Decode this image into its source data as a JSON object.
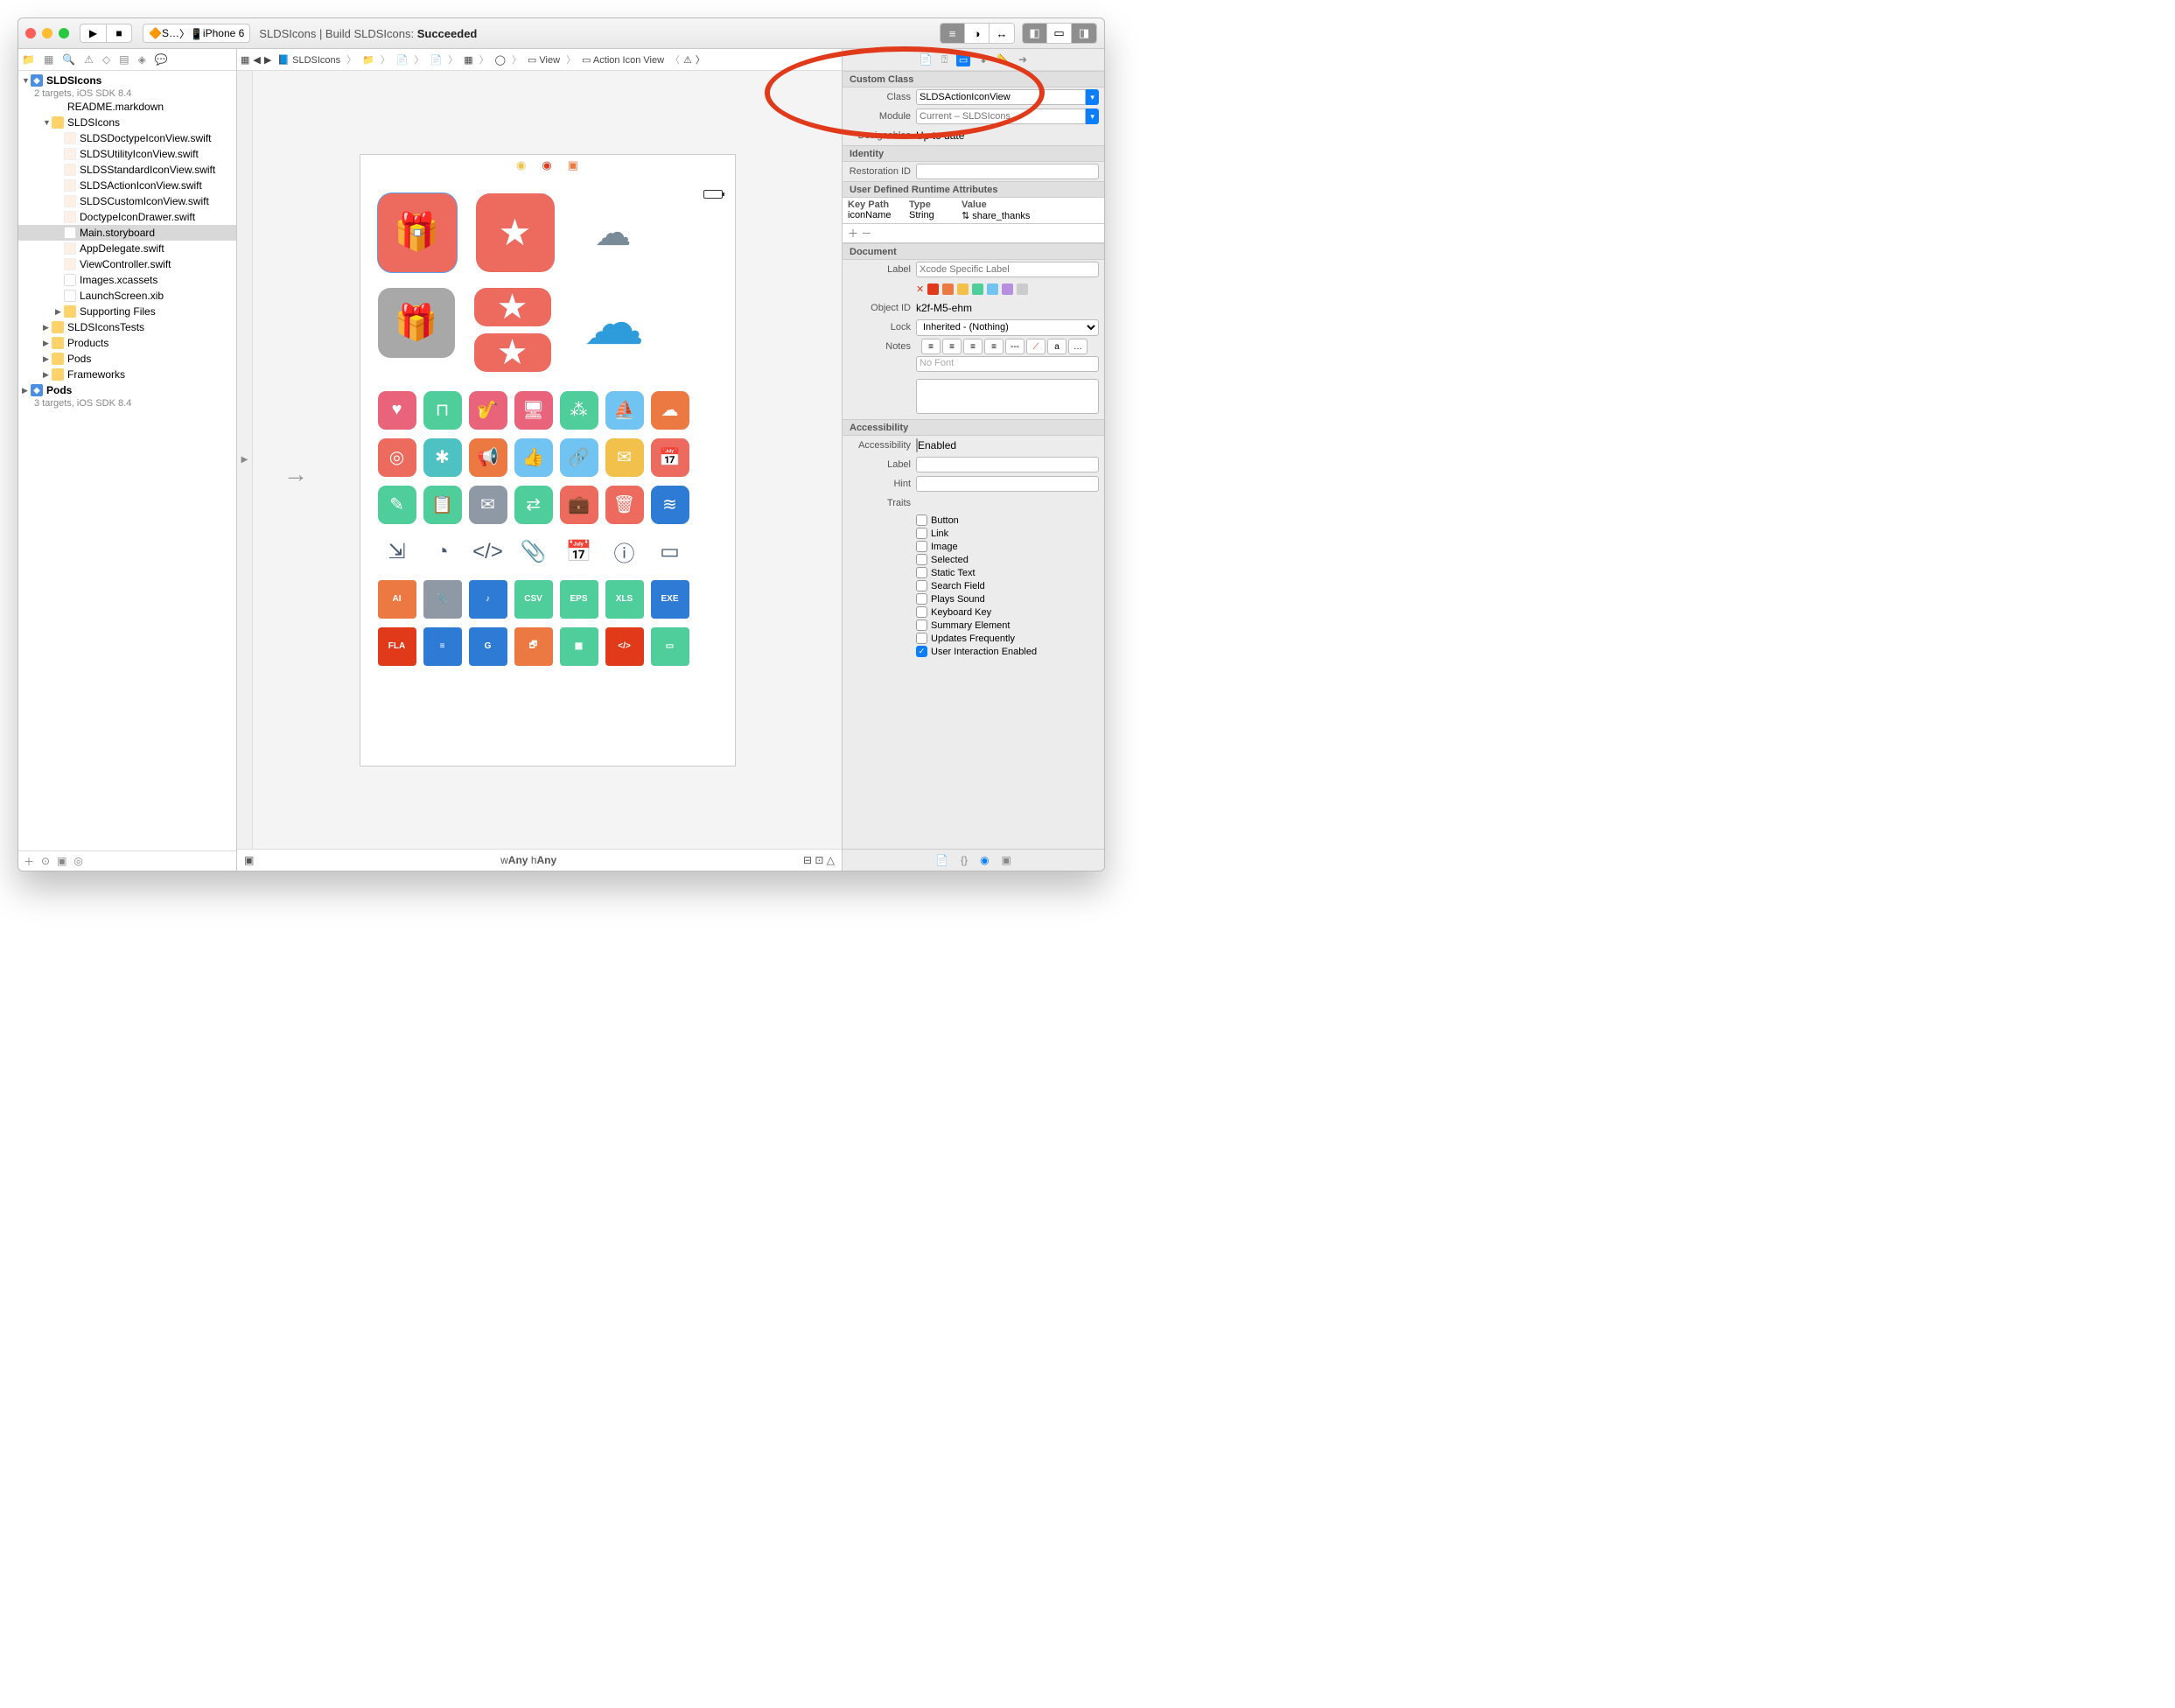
{
  "titlebar": {
    "scheme_target": "S…",
    "scheme_device": "iPhone 6",
    "build_status_prefix": "SLDSIcons  |  Build SLDSIcons: ",
    "build_status_result": "Succeeded"
  },
  "navigator": {
    "project": "SLDSIcons",
    "project_sub": "2 targets, iOS SDK 8.4",
    "files": [
      {
        "name": "README.markdown",
        "type": "file",
        "indent": 2
      },
      {
        "name": "SLDSIcons",
        "type": "folder",
        "indent": 2,
        "open": true
      },
      {
        "name": "SLDSDoctypeIconView.swift",
        "type": "swift",
        "indent": 3
      },
      {
        "name": "SLDSUtilityIconView.swift",
        "type": "swift",
        "indent": 3
      },
      {
        "name": "SLDSStandardIconView.swift",
        "type": "swift",
        "indent": 3
      },
      {
        "name": "SLDSActionIconView.swift",
        "type": "swift",
        "indent": 3
      },
      {
        "name": "SLDSCustomIconView.swift",
        "type": "swift",
        "indent": 3
      },
      {
        "name": "DoctypeIconDrawer.swift",
        "type": "swift",
        "indent": 3
      },
      {
        "name": "Main.storyboard",
        "type": "story",
        "indent": 3,
        "sel": true
      },
      {
        "name": "AppDelegate.swift",
        "type": "swift",
        "indent": 3
      },
      {
        "name": "ViewController.swift",
        "type": "swift",
        "indent": 3
      },
      {
        "name": "Images.xcassets",
        "type": "xc",
        "indent": 3
      },
      {
        "name": "LaunchScreen.xib",
        "type": "xib",
        "indent": 3
      },
      {
        "name": "Supporting Files",
        "type": "folder",
        "indent": 3
      },
      {
        "name": "SLDSIconsTests",
        "type": "folder",
        "indent": 2
      },
      {
        "name": "Products",
        "type": "folder",
        "indent": 2
      },
      {
        "name": "Pods",
        "type": "folder",
        "indent": 2
      },
      {
        "name": "Frameworks",
        "type": "folder",
        "indent": 2
      }
    ],
    "project2": "Pods",
    "project2_sub": "3 targets, iOS SDK 8.4"
  },
  "jumpbar": {
    "items": [
      "SLDSIcons",
      "",
      "",
      "",
      "",
      "",
      "View",
      "Action Icon View"
    ]
  },
  "editor_footer": {
    "wAny": "w",
    "any": "Any",
    "hAny": "h"
  },
  "inspector": {
    "custom_class": {
      "header": "Custom Class",
      "class_lbl": "Class",
      "class_val": "SLDSActionIconView",
      "module_lbl": "Module",
      "module_ph": "Current – SLDSIcons",
      "designables_lbl": "Designables",
      "designables_val": "Up to date"
    },
    "identity": {
      "header": "Identity",
      "restoration_lbl": "Restoration ID"
    },
    "runtime": {
      "header": "User Defined Runtime Attributes",
      "cols": [
        "Key Path",
        "Type",
        "Value"
      ],
      "row": {
        "key": "iconName",
        "type": "String",
        "value": "share_thanks"
      }
    },
    "document": {
      "header": "Document",
      "label_lbl": "Label",
      "label_ph": "Xcode Specific Label",
      "objectid_lbl": "Object ID",
      "objectid_val": "k2f-M5-ehm",
      "lock_lbl": "Lock",
      "lock_val": "Inherited - (Nothing)",
      "notes_lbl": "Notes",
      "nofont": "No Font"
    },
    "accessibility": {
      "header": "Accessibility",
      "acc_lbl": "Accessibility",
      "enabled": "Enabled",
      "label_lbl": "Label",
      "hint_lbl": "Hint",
      "traits_lbl": "Traits",
      "traits": [
        "Button",
        "Link",
        "Image",
        "Selected",
        "Static Text",
        "Search Field",
        "Plays Sound",
        "Keyboard Key",
        "Summary Element",
        "Updates Frequently",
        "User Interaction Enabled"
      ]
    }
  },
  "icon_colors": {
    "gift": "#ed6a5e",
    "star": "#ed6a5e",
    "cloud": "#7a8b98",
    "gift2_bg": "#a8a8a8",
    "star2": "#ed6a5e",
    "cloud2": "#2e9bdb",
    "grid_row1": [
      "#e9637a",
      "#4fce9b",
      "#e9637a",
      "#e9637a",
      "#4fce9b",
      "#71c3f1",
      "#ec7842"
    ],
    "grid_row2": [
      "#ed6a5e",
      "#4ec1c3",
      "#ec7842",
      "#71c3f1",
      "#71c3f1",
      "#f2c14b",
      "#ed6a5e"
    ],
    "grid_row3": [
      "#4fce9b",
      "#4fce9b",
      "#8f99a5",
      "#4fce9b",
      "#ed6a5e",
      "#ed6a5e",
      "#2e7bd6"
    ],
    "doc_row1": [
      "#ec7842",
      "#8f99a5",
      "#2e7bd6",
      "#4fce9b",
      "#4fce9b",
      "#4fce9b",
      "#2e7bd6"
    ],
    "doc_row2": [
      "#e03a1a",
      "#2e7bd6",
      "#2e7bd6",
      "#ec7842",
      "#4fce9b",
      "#e03a1a",
      "#4fce9b"
    ],
    "doc_labels1": [
      "AI",
      "📎",
      "♪",
      "CSV",
      "EPS",
      "XLS",
      "EXE"
    ],
    "doc_labels2": [
      "FLA",
      "≡",
      "G",
      "🗗",
      "▦",
      "</>",
      "▭"
    ]
  }
}
